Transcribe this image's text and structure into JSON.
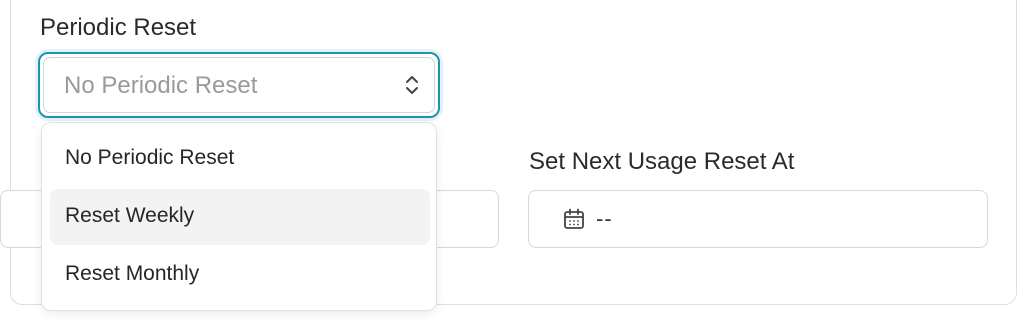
{
  "periodic_reset": {
    "label": "Periodic Reset",
    "selected_value": "No Periodic Reset",
    "options": [
      "No Periodic Reset",
      "Reset Weekly",
      "Reset Monthly"
    ],
    "highlighted_option": "Reset Weekly"
  },
  "next_usage_reset": {
    "label": "Set Next Usage Reset At",
    "value": "--",
    "icon": "calendar-icon"
  },
  "colors": {
    "focus_border": "#1f93ad",
    "option_hover": "#f3f3f3",
    "placeholder_text": "#9a9a9a"
  }
}
